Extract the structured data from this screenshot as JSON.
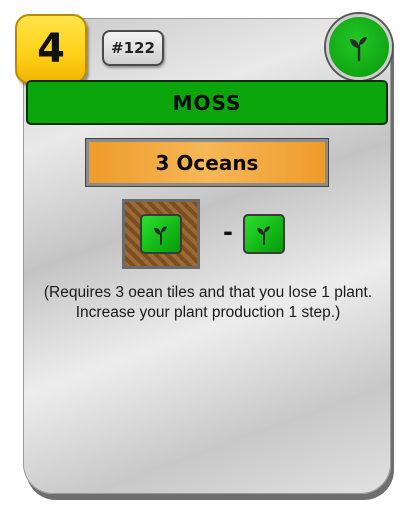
{
  "card": {
    "cost": "4",
    "number": "#122",
    "title": "MOSS",
    "tag_icon": "plant-sprout-icon",
    "requirement": "3 Oceans",
    "effects": {
      "production_icon": "plant-production-icon",
      "operator": "-",
      "resource_icon": "plant-resource-icon"
    },
    "description": "(Requires 3 oean tiles and that you lose 1 plant. Increase your plant production 1 step.)"
  },
  "colors": {
    "cost_badge": "#ffd21a",
    "title_bar": "#0aa60c",
    "requirement_bar": "#f0a33a",
    "plant_tag": "#11a614",
    "production_box": "#8b5a2b"
  }
}
